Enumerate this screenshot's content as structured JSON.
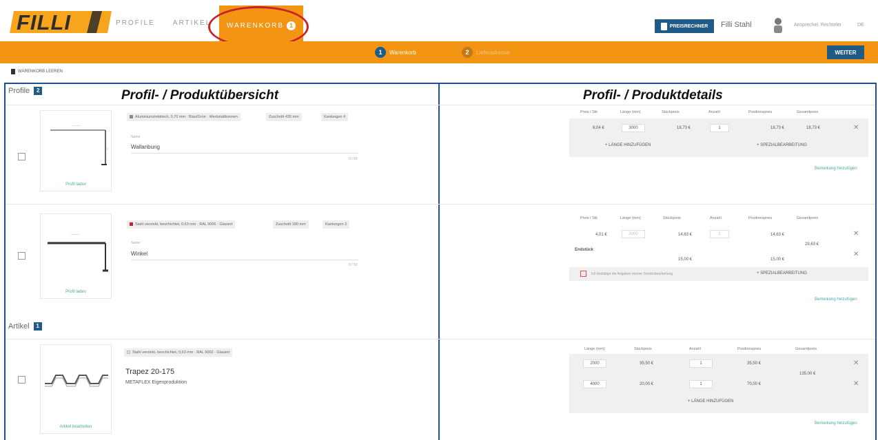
{
  "header": {
    "logo_text": "FILLI",
    "nav": [
      "PROFILE",
      "ARTIKEL"
    ],
    "active_nav": "WARENKORB",
    "cart_count": "1",
    "calc_button": "PREISRECHNER",
    "user_name": "Filli Stahl",
    "user_sub": "Ansprechel. Rechteler",
    "lang": "DE"
  },
  "steps": [
    {
      "num": "1",
      "label": "Warenkorb"
    },
    {
      "num": "2",
      "label": "Lieferadresse"
    }
  ],
  "next_button": "WEITER",
  "clear_cart": "WARENKORB LEEREN",
  "annotations": {
    "left": "Profil- / Produktübersicht",
    "right": "Profil- / Produktdetails"
  },
  "sections": {
    "profile_title": "Profile",
    "profile_count": "2",
    "artikel_title": "Artikel",
    "artikel_count": "1"
  },
  "profiles": [
    {
      "tags": "Aluminiumzinkblech, 0,70 mm · Blau/Grün · Werkstattkonnen",
      "zuschnitt": "Zuschnitt 435 mm",
      "kantungen": "Kantungen 4",
      "field_label": "Name",
      "name": "Wallanbung",
      "counter": "0 / 50",
      "link": "Profil ladev",
      "table": {
        "headers": [
          "Preis / Stk",
          "Länge (mm)",
          "Stückpreis",
          "Anzahl",
          "Positionspreis",
          "Gesamtpreis"
        ],
        "values": [
          "8,04 €",
          "3000",
          "18,73 €",
          "1",
          "18,73 €",
          "18,73 €"
        ],
        "add_length": "+ LÄNGE HINZUFÜGEN",
        "special": "+ SPEZIALBEARBEITUNG",
        "comment": "Bemerkung hinzufügen"
      }
    },
    {
      "tags": "Stahl verzinkt, beschichtet, 0,63 mm · RAL 9006 · Glasiert",
      "zuschnitt": "Zuschnitt 180 mm",
      "kantungen": "Kantungen 3",
      "field_label": "Name",
      "name": "Winkel",
      "counter": "0 / 50",
      "link": "Profil ladev",
      "table": {
        "headers": [
          "Preis / Stk",
          "Länge (mm)",
          "Stückpreis",
          "Anzahl",
          "Positionspreis",
          "Gesamtpreis"
        ],
        "values": [
          "4,01 €",
          "2000",
          "14,63 €",
          "1",
          "14,63 €",
          "29,63 €"
        ],
        "extra_label": "Endstück",
        "extra_values": [
          "15,00 €",
          "15,00 €"
        ],
        "checkbox_note": "Ich bestätige die Angaben meiner Sonderbearbeitung",
        "special": "+ SPEZIALBEARBEITUNG",
        "comment": "Bemerkung hinzufügen"
      }
    }
  ],
  "artikel": {
    "tag": "Stahl verzinkt, beschichtet, 0,63 mm · RAL 9002 · Glasiert",
    "title": "Trapez 20-175",
    "subtitle": "METAFLEX Eigenproduktion",
    "link": "Artikel bearbeiten",
    "table": {
      "headers": [
        "Länge (mm)",
        "Stückpreis",
        "Anzahl",
        "Positionspreis",
        "Gesamtpreis"
      ],
      "rows": [
        [
          "2000",
          "35,50 €",
          "1",
          "35,50 €"
        ],
        [
          "4000",
          "20,00 €",
          "1",
          "70,00 €"
        ]
      ],
      "total": "135,00 €",
      "add_length": "+ LÄNGE HINZUFÜGEN",
      "comment": "Bemerkung hinzufügen"
    }
  },
  "colors": {
    "orange": "#f39512",
    "navy": "#1f5b86",
    "annotation_red": "#c8232c",
    "panel_blue": "#1e4f8a"
  }
}
